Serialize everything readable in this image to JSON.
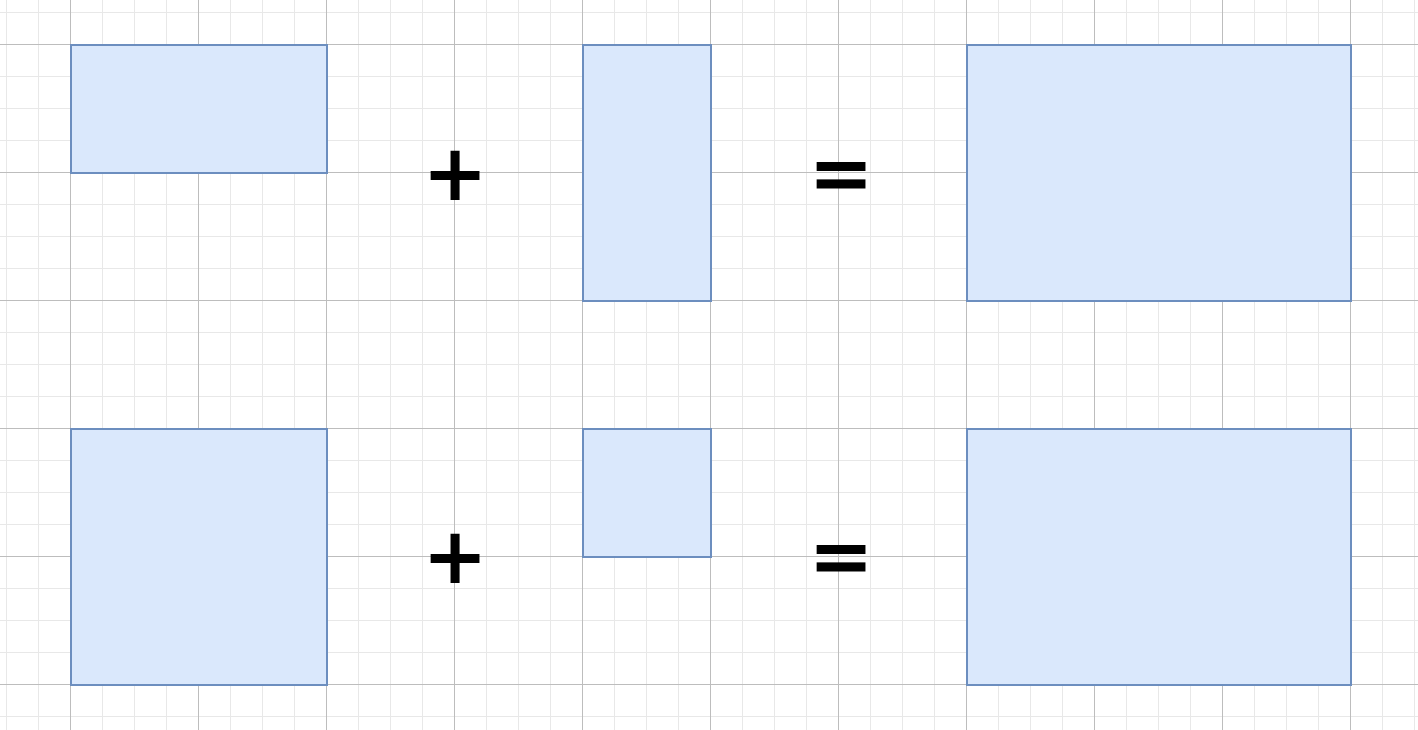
{
  "diagram": {
    "fill_color": "#dae8fc",
    "stroke_color": "#6c8ebf",
    "grid_major_color": "#bdbdbd",
    "grid_minor_color": "#e8e8e8",
    "rows": [
      {
        "operand1": "rectangle",
        "operator_plus": "+",
        "operand2": "rectangle",
        "operator_equals": "=",
        "result": "rectangle"
      },
      {
        "operand1": "rectangle",
        "operator_plus": "+",
        "operand2": "rectangle",
        "operator_equals": "=",
        "result": "rectangle"
      }
    ]
  }
}
